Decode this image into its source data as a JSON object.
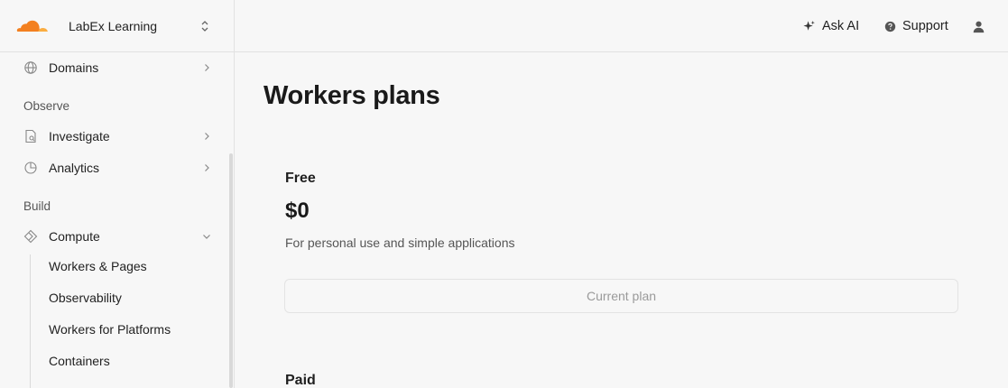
{
  "account": {
    "name": "LabEx Learning"
  },
  "sidebar": {
    "items": [
      {
        "label": "Domains"
      },
      {
        "label": "Investigate"
      },
      {
        "label": "Analytics"
      },
      {
        "label": "Compute"
      }
    ],
    "sections": {
      "observe": "Observe",
      "build": "Build"
    },
    "compute_sub": [
      {
        "label": "Workers & Pages"
      },
      {
        "label": "Observability"
      },
      {
        "label": "Workers for Platforms"
      },
      {
        "label": "Containers"
      }
    ]
  },
  "header": {
    "ask_ai": "Ask AI",
    "support": "Support"
  },
  "main": {
    "title": "Workers plans",
    "plans": [
      {
        "name": "Free",
        "price": "$0",
        "description": "For personal use and simple applications",
        "button": "Current plan"
      },
      {
        "name": "Paid"
      }
    ]
  },
  "colors": {
    "brand": "#f38020",
    "brand_light": "#fbad41"
  }
}
